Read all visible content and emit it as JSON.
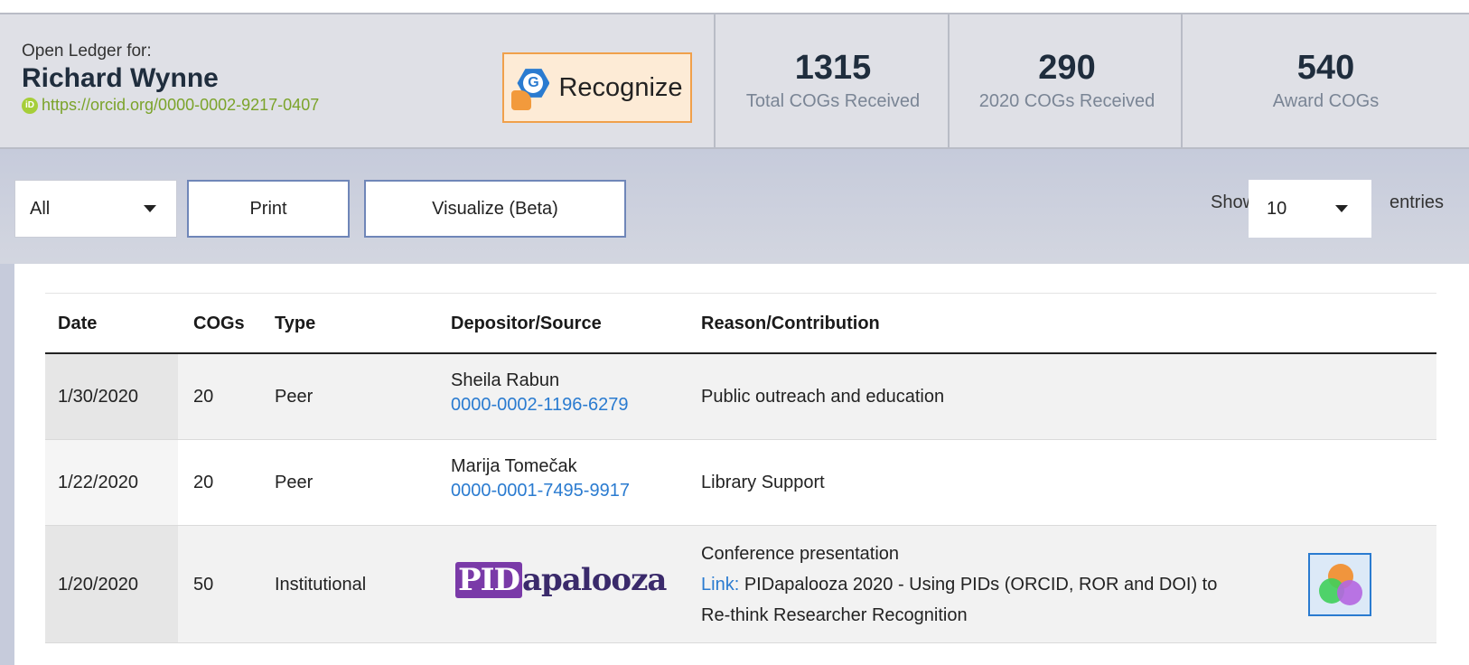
{
  "header": {
    "owner_label": "Open Ledger for:",
    "owner_name": "Richard Wynne",
    "orcid_icon": "iD",
    "orcid_url": "https://orcid.org/0000-0002-9217-0407",
    "recognize_label": "Recognize",
    "stats": [
      {
        "value": "1315",
        "caption": "Total COGs Received"
      },
      {
        "value": "290",
        "caption": "2020 COGs Received"
      },
      {
        "value": "540",
        "caption": "Award COGs"
      }
    ]
  },
  "controls": {
    "filter_value": "All",
    "print_label": "Print",
    "visualize_label": "Visualize (Beta)",
    "show_label": "Show",
    "entries_value": "10",
    "entries_label": "entries"
  },
  "table": {
    "columns": [
      "Date",
      "COGs",
      "Type",
      "Depositor/Source",
      "Reason/Contribution"
    ],
    "rows": [
      {
        "date": "1/30/2020",
        "cogs": "20",
        "type": "Peer",
        "depositor_name": "Sheila Rabun",
        "depositor_id": "0000-0002-1196-6279",
        "reason": "Public outreach and education"
      },
      {
        "date": "1/22/2020",
        "cogs": "20",
        "type": "Peer",
        "depositor_name": "Marija Tomečak",
        "depositor_id": "0000-0001-7495-9917",
        "reason": "Library Support"
      },
      {
        "date": "1/20/2020",
        "cogs": "50",
        "type": "Institutional",
        "depositor_logo_text": "PIDapalooza",
        "depositor_logo_prefix": "PID",
        "depositor_logo_suffix": "apalooza",
        "reason_line1": "Conference presentation",
        "reason_link_label": "Link:",
        "reason_link_text": "PIDapalooza 2020 - Using PIDs (ORCID, ROR and DOI) to",
        "reason_line3": "Re-think Researcher Recognition"
      }
    ]
  },
  "colors": {
    "accent_blue": "#2a7bd0",
    "orcid_green": "#a6ce39",
    "recognize_bg": "#fdebd6",
    "recognize_border": "#f0a04b"
  }
}
